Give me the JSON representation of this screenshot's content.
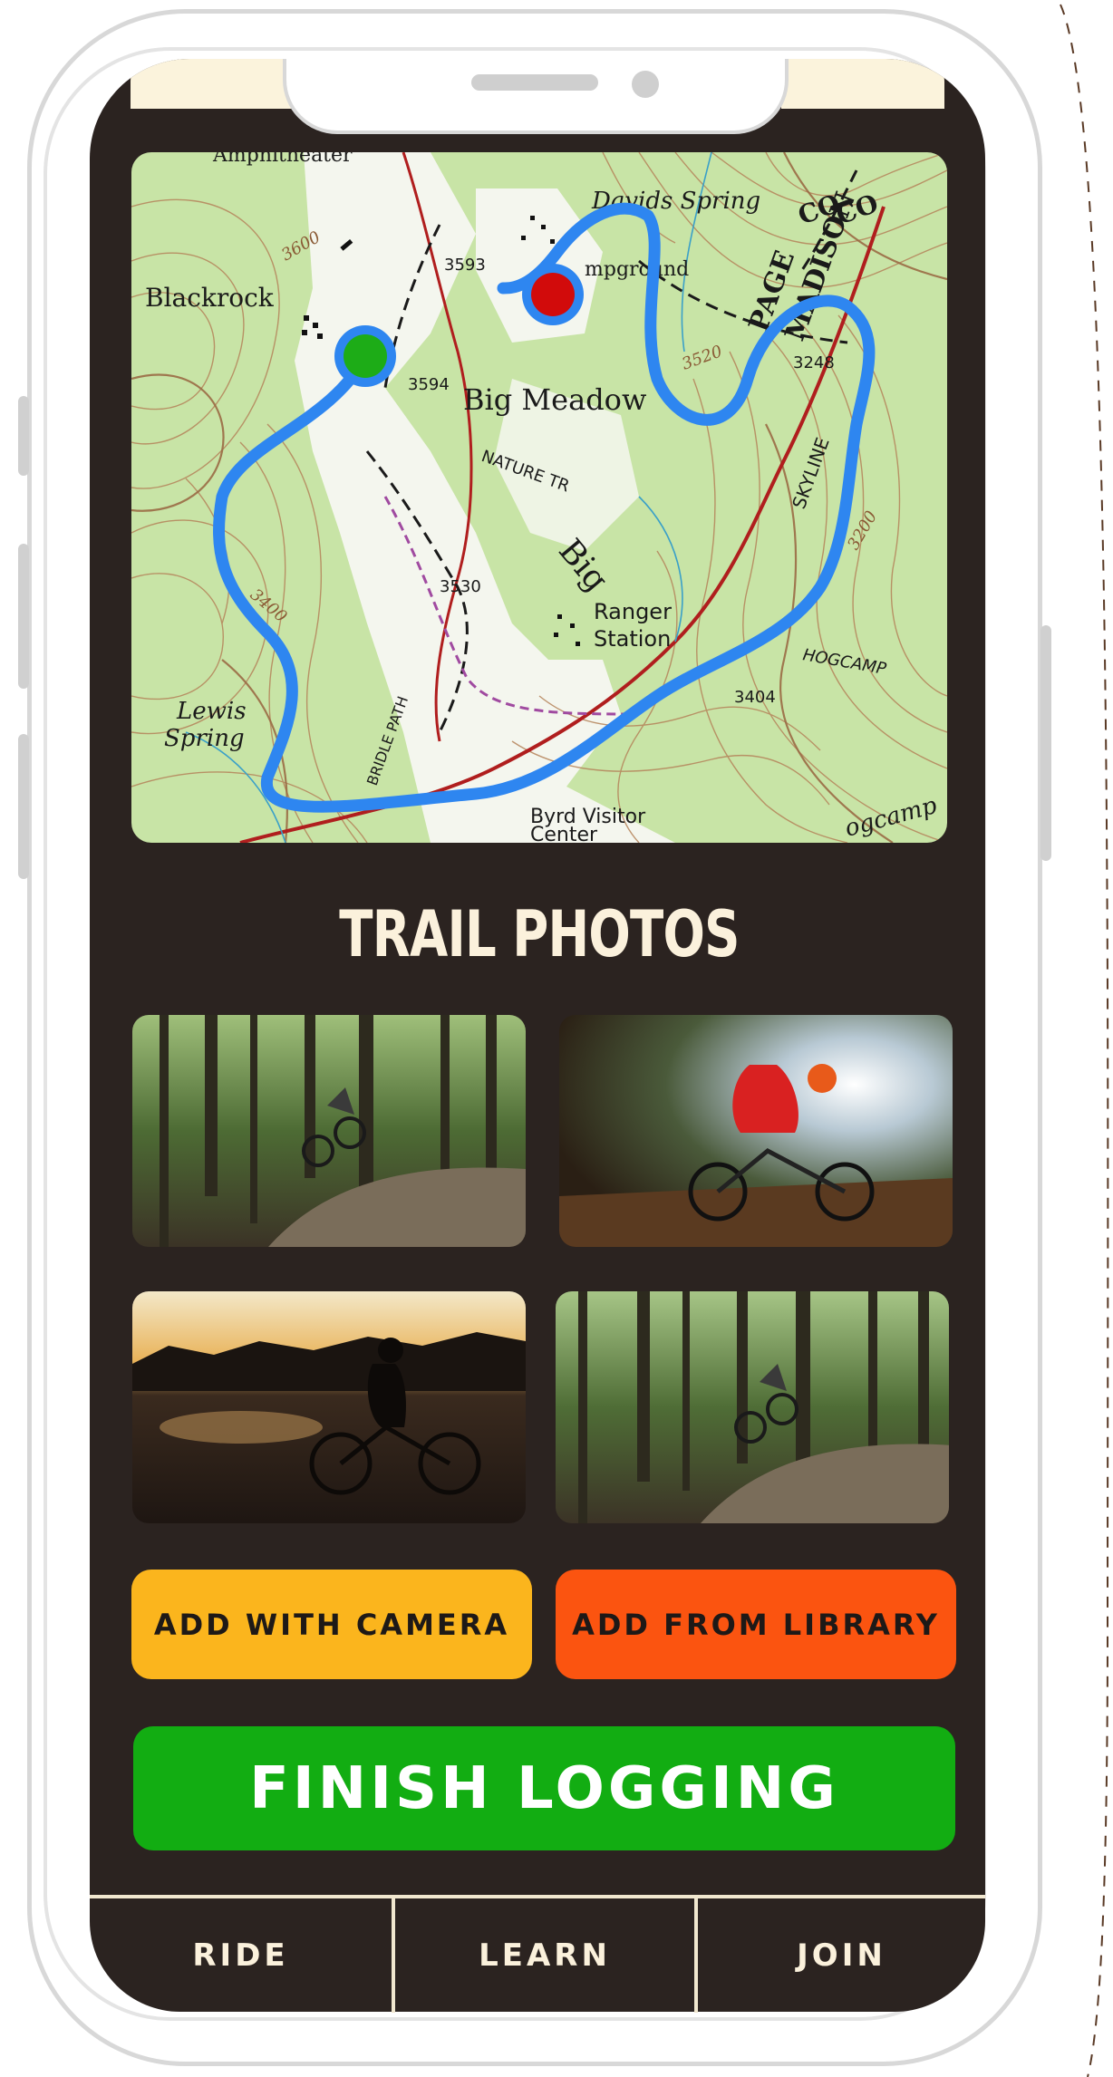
{
  "map": {
    "labels": {
      "amphitheater": "Amphitheater",
      "blackrock": "Blackrock",
      "big_meadow": "Big Meadow",
      "davids_spring": "Davids Spring",
      "campground": "mpground",
      "page": "PAGE",
      "madison": "MADISON",
      "co1": "CO",
      "co2": "CO",
      "nature_tr": "NATURE TR",
      "big": "Big",
      "skyline": "SKYLINE",
      "ranger_station_1": "Ranger",
      "ranger_station_2": "Station",
      "hogcamp": "HOGCAMP",
      "lewis_spring_1": "Lewis",
      "lewis_spring_2": "Spring",
      "byrd_visitor_1": "Byrd Visitor",
      "byrd_visitor_2": "Center",
      "bridle_path": "BRIDLE PATH",
      "elev_3593": "3593",
      "elev_3594": "3594",
      "elev_3530": "3530",
      "elev_3248": "3248",
      "elev_3404": "3404",
      "elev_3600": "3600",
      "elev_3400": "3400",
      "elev_3520": "3520",
      "elev_3200": "3200",
      "hogcamp_branch": "ogcamp"
    },
    "start_marker_color": "#1dac17",
    "end_marker_color": "#d20b0b",
    "route_color": "#2e86f0"
  },
  "section_title": "TRAIL PHOTOS",
  "photos": [
    {
      "icon": "forest-rider-photo"
    },
    {
      "icon": "motion-blur-rider-photo"
    },
    {
      "icon": "sunset-rider-photo"
    },
    {
      "icon": "forest-descent-photo"
    }
  ],
  "buttons": {
    "camera": "ADD WITH CAMERA",
    "library": "ADD FROM LIBRARY",
    "finish": "FINISH LOGGING"
  },
  "colors": {
    "camera_bg": "#fbb51d",
    "library_bg": "#fb5410",
    "finish_bg": "#12ad12",
    "screen_bg": "#2b2320"
  },
  "tabs": [
    {
      "label": "RIDE"
    },
    {
      "label": "LEARN"
    },
    {
      "label": "JOIN"
    }
  ]
}
